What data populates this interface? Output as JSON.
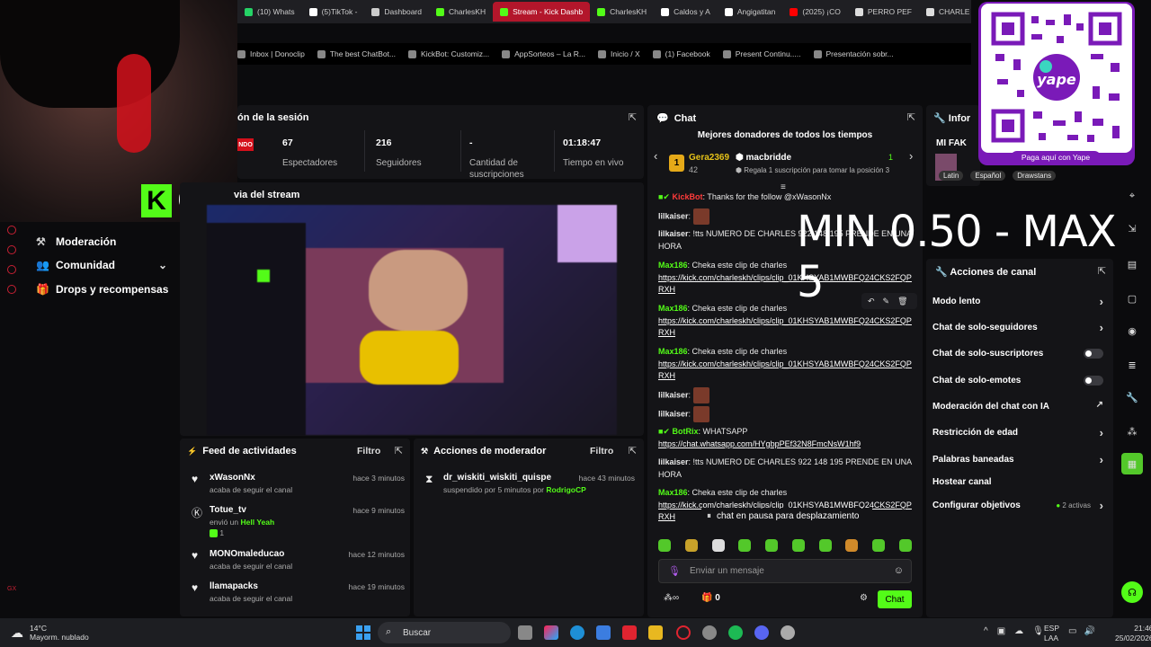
{
  "browser": {
    "tabs": [
      {
        "label": "(10) Whats",
        "color": "#25d366",
        "active": false
      },
      {
        "label": "(5)TikTok -",
        "color": "#ffffff",
        "active": false
      },
      {
        "label": "Dashboard",
        "color": "#cccccc",
        "active": false
      },
      {
        "label": "CharlesKH",
        "color": "#53fc18",
        "active": false
      },
      {
        "label": "Stream - Kick Dashb",
        "color": "#53fc18",
        "active": true
      },
      {
        "label": "CharlesKH",
        "color": "#53fc18",
        "active": false
      },
      {
        "label": "Caldos y A",
        "color": "#ffffff",
        "active": false
      },
      {
        "label": "Angigatitan",
        "color": "#ffffff",
        "active": false
      },
      {
        "label": "(2025) ¡CO",
        "color": "#ff0000",
        "active": false
      },
      {
        "label": "PERRO PEF",
        "color": "#dddddd",
        "active": false
      },
      {
        "label": "CHARLE",
        "color": "#dddddd",
        "active": false
      }
    ],
    "bookmarks": [
      "Inbox | Donoclip",
      "The best ChatBot...",
      "KickBot: Customiz...",
      "AppSorteos – La R...",
      "Inicio / X",
      "(1) Facebook",
      "Present Continu.....",
      "Presentación sobr..."
    ]
  },
  "webcam": {
    "badge_letter": "K",
    "viewer_count": "67"
  },
  "sidebar": {
    "items": [
      {
        "label": "Moderación",
        "icon": "gavel-icon"
      },
      {
        "label": "Comunidad",
        "icon": "users-icon"
      },
      {
        "label": "Drops y recompensas",
        "icon": "gift-icon"
      }
    ]
  },
  "session": {
    "title": "ón de la sesión",
    "live_badge": "NDO",
    "stats": [
      {
        "value": "67",
        "label": "Espectadores"
      },
      {
        "value": "216",
        "label": "Seguidores"
      },
      {
        "value": "-",
        "label": "Cantidad de suscripciones"
      },
      {
        "value": "01:18:47",
        "label": "Tiempo en vivo"
      }
    ]
  },
  "preview": {
    "title": "via del stream"
  },
  "feed": {
    "title": "Feed de actividades",
    "filter": "Filtro",
    "items": [
      {
        "name": "xWasonNx",
        "time": "hace 3 minutos",
        "sub": "acaba de seguir el canal",
        "icon": "heart-icon"
      },
      {
        "name": "Totue_tv",
        "time": "hace 9 minutos",
        "sub": "envió un",
        "sub_highlight": "Hell Yeah",
        "count": "1",
        "icon": "kick-gift-icon"
      },
      {
        "name": "MONOmaleducao",
        "time": "hace 12 minutos",
        "sub": "acaba de seguir el canal",
        "icon": "heart-icon"
      },
      {
        "name": "llamapacks",
        "time": "hace 19 minutos",
        "sub": "acaba de seguir el canal",
        "icon": "heart-icon"
      }
    ]
  },
  "modactions": {
    "title": "Acciones de moderador",
    "filter": "Filtro",
    "items": [
      {
        "name": "dr_wiskiti_wiskiti_quispe",
        "time": "hace 43 minutos",
        "sub": "suspendido por 5 minutos por",
        "by": "RodrigoCP"
      }
    ]
  },
  "chat": {
    "title": "Chat",
    "donors_title": "Mejores donadores de todos los tiempos",
    "donor1": {
      "name": "Gera2369",
      "amount": "42",
      "rank": "1"
    },
    "donor2": {
      "name": "macbridde",
      "count": "1",
      "note": "Regala 1 suscripción para tomar la posición 3"
    },
    "messages": [
      {
        "user": "KickBot",
        "user_color": "#ff3b3b",
        "text": ": Thanks for the follow @xWasonNx"
      },
      {
        "user": "lilkaiser",
        "user_color": "#dcdcdc",
        "text": ":",
        "emote": true
      },
      {
        "user": "lilkaiser",
        "user_color": "#dcdcdc",
        "text": ": !tts NUMERO DE CHARLES 922 148 195 PRENDE EN UNA HORA"
      },
      {
        "user": "Max186",
        "user_color": "#53fc18",
        "text": ": Cheka este clip de charles",
        "link": "https://kick.com/charleskh/clips/clip_01KHSYAB1MWBFQ24CKS2FQPRXH"
      },
      {
        "user": "Max186",
        "user_color": "#53fc18",
        "text": ": Cheka este clip de charles",
        "link": "https://kick.com/charleskh/clips/clip_01KHSYAB1MWBFQ24CKS2FQPRXH"
      },
      {
        "user": "Max186",
        "user_color": "#53fc18",
        "text": ": Cheka este clip de charles",
        "link": "https://kick.com/charleskh/clips/clip_01KHSYAB1MWBFQ24CKS2FQPRXH"
      },
      {
        "user": "lilkaiser",
        "user_color": "#dcdcdc",
        "text": ":",
        "emote": true
      },
      {
        "user": "lilkaiser",
        "user_color": "#dcdcdc",
        "text": ":",
        "emote": true
      },
      {
        "user": "BotRix",
        "user_color": "#53fc18",
        "text": ": WHATSAPP",
        "link": "https://chat.whatsapp.com/HYgbpPEf32N8FmcNsW1hf9"
      },
      {
        "user": "lilkaiser",
        "user_color": "#dcdcdc",
        "text": ": !tts NUMERO DE CHARLES 922 148 195 PRENDE EN UNA HORA"
      },
      {
        "user": "Max186",
        "user_color": "#53fc18",
        "text": ": Cheka este clip de charles",
        "link": "https://kick.com/charleskh/clips/clip_01KHSYAB1MWBFQ24CKS2FQPRXH"
      }
    ],
    "paused": "chat en pausa para desplazamiento",
    "input_placeholder": "Enviar un mensaje",
    "points": "0",
    "send": "Chat"
  },
  "overlay": {
    "text": "MIN 0.50 - MAX 5"
  },
  "info": {
    "title": "Infor",
    "label": "MI FAK",
    "tags": [
      "Latin",
      "Español",
      "Drawstans"
    ]
  },
  "channel": {
    "title": "Acciones de canal",
    "items": [
      {
        "label": "Modo lento",
        "control": "chevron"
      },
      {
        "label": "Chat de solo-seguidores",
        "control": "chevron"
      },
      {
        "label": "Chat de solo-suscriptores",
        "control": "toggle"
      },
      {
        "label": "Chat de solo-emotes",
        "control": "toggle"
      },
      {
        "label": "Moderación del chat con IA",
        "control": "external"
      },
      {
        "label": "Restricción de edad",
        "control": "chevron"
      },
      {
        "label": "Palabras baneadas",
        "control": "chevron"
      },
      {
        "label": "Hostear canal",
        "control": "none"
      },
      {
        "label": "Configurar objetivos",
        "control": "chevron",
        "extra": "2 activas"
      }
    ]
  },
  "qr": {
    "brand": "yape",
    "caption": "Paga aquí con Yape"
  },
  "taskbar": {
    "weather_temp": "14°C",
    "weather_desc": "Mayorm. nublado",
    "search": "Buscar",
    "lang": "ESP",
    "lang2": "LAA",
    "time": "21:46",
    "date": "25/02/2026"
  },
  "colors": {
    "kick_green": "#53fc18",
    "panel": "#141417",
    "live_red": "#d4101b",
    "yape_purple": "#7a1ab8"
  }
}
